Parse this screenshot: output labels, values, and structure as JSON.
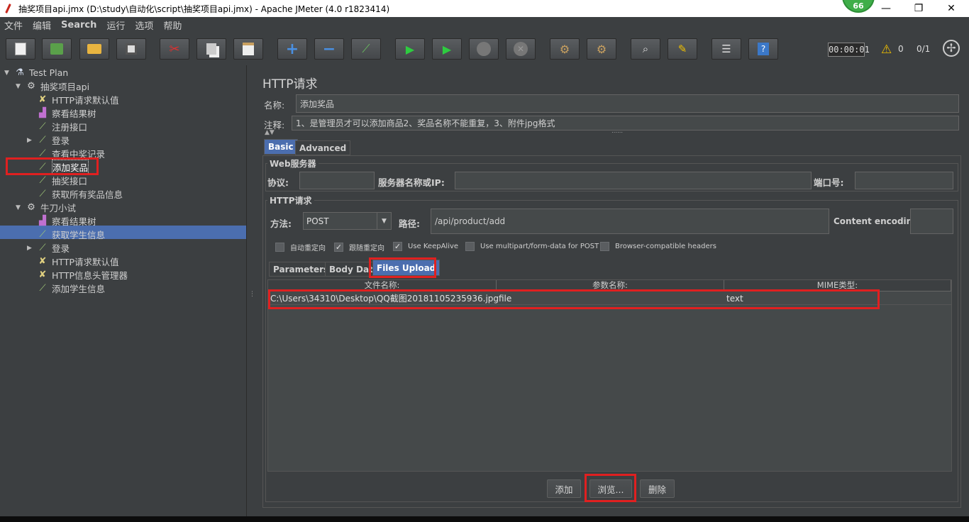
{
  "window": {
    "title": "抽奖项目api.jmx (D:\\study\\自动化\\script\\抽奖项目api.jmx) - Apache JMeter (4.0 r1823414)",
    "badge": "66",
    "minimize": "—",
    "maximize": "❐",
    "close": "✕"
  },
  "menu": [
    "文件",
    "编辑",
    "Search",
    "运行",
    "选项",
    "帮助"
  ],
  "toolbar": {
    "icons": [
      "new-icon",
      "templates-icon",
      "open-icon",
      "save-icon",
      "cut-icon",
      "copy-icon",
      "paste-icon",
      "expand-icon",
      "collapse-icon",
      "toggle-icon",
      "start-icon",
      "start-no-pause-icon",
      "stop-icon",
      "shutdown-icon",
      "clear-icon",
      "clear-all-icon",
      "search-icon",
      "reset-search-icon",
      "function-helper-icon",
      "help-icon"
    ],
    "timer": "00:00:01",
    "warnings": "0",
    "threads": "0/1"
  },
  "tree": {
    "items": [
      {
        "label": "Test Plan",
        "icon": "testplan-icon",
        "level": 0,
        "arrow": "▼"
      },
      {
        "label": "抽奖项目api",
        "icon": "gear-icon",
        "level": 1,
        "arrow": "▼"
      },
      {
        "label": "HTTP请求默认值",
        "icon": "wrench-icon",
        "level": 2,
        "arrow": ""
      },
      {
        "label": "察看结果树",
        "icon": "chart-icon",
        "level": 2,
        "arrow": ""
      },
      {
        "label": "注册接口",
        "icon": "pipette-icon",
        "level": 2,
        "arrow": ""
      },
      {
        "label": "登录",
        "icon": "pipette-icon",
        "level": 2,
        "arrow": "▶"
      },
      {
        "label": "查看中奖记录",
        "icon": "pipette-icon",
        "level": 2,
        "arrow": ""
      },
      {
        "label": "添加奖品",
        "icon": "pipette-icon",
        "level": 2,
        "arrow": ""
      },
      {
        "label": "抽奖接口",
        "icon": "pipette-icon",
        "level": 2,
        "arrow": ""
      },
      {
        "label": "获取所有奖品信息",
        "icon": "pipette-icon",
        "level": 2,
        "arrow": ""
      },
      {
        "label": "牛刀小试",
        "icon": "gear-icon",
        "level": 1,
        "arrow": "▼"
      },
      {
        "label": "察看结果树",
        "icon": "chart-icon",
        "level": 2,
        "arrow": ""
      },
      {
        "label": "获取学生信息",
        "icon": "pipette-icon",
        "level": 2,
        "arrow": ""
      },
      {
        "label": "登录",
        "icon": "pipette-icon",
        "level": 2,
        "arrow": "▶"
      },
      {
        "label": "HTTP请求默认值",
        "icon": "wrench-icon",
        "level": 2,
        "arrow": ""
      },
      {
        "label": "HTTP信息头管理器",
        "icon": "wrench-icon",
        "level": 2,
        "arrow": ""
      },
      {
        "label": "添加学生信息",
        "icon": "pipette-icon",
        "level": 2,
        "arrow": ""
      }
    ]
  },
  "panel": {
    "title": "HTTP请求",
    "name_label": "名称:",
    "name_value": "添加奖品",
    "comment_label": "注释:",
    "comment_value": "1、是管理员才可以添加商品2、奖品名称不能重复，3、附件jpg格式",
    "tabs": [
      "Basic",
      "Advanced"
    ],
    "web_server": {
      "legend": "Web服务器",
      "protocol_label": "协议:",
      "server_label": "服务器名称或IP:",
      "port_label": "端口号:",
      "protocol_value": "",
      "server_value": "",
      "port_value": ""
    },
    "http_request": {
      "legend": "HTTP请求",
      "method_label": "方法:",
      "method_value": "POST",
      "path_label": "路径:",
      "path_value": "/api/product/add",
      "encoding_label": "Content encoding:",
      "encoding_value": ""
    },
    "checkboxes": [
      {
        "label": "自动重定向",
        "checked": false
      },
      {
        "label": "跟随重定向",
        "checked": true
      },
      {
        "label": "Use KeepAlive",
        "checked": true
      },
      {
        "label": "Use multipart/form-data for POST",
        "checked": false
      },
      {
        "label": "Browser-compatible headers",
        "checked": false
      }
    ],
    "sub_tabs": [
      "Parameters",
      "Body Data",
      "Files Upload"
    ],
    "table": {
      "headers": [
        "文件名称:",
        "参数名称:",
        "MIME类型:"
      ],
      "rows": [
        [
          "C:\\Users\\34310\\Desktop\\QQ截图20181105235936.jpg",
          "file",
          "text"
        ]
      ]
    },
    "buttons": {
      "add": "添加",
      "browse": "浏览...",
      "delete": "删除"
    }
  },
  "colors": {
    "selection": "#4b6eaf",
    "highlight": "#e02020",
    "background": "#3c3f41"
  }
}
